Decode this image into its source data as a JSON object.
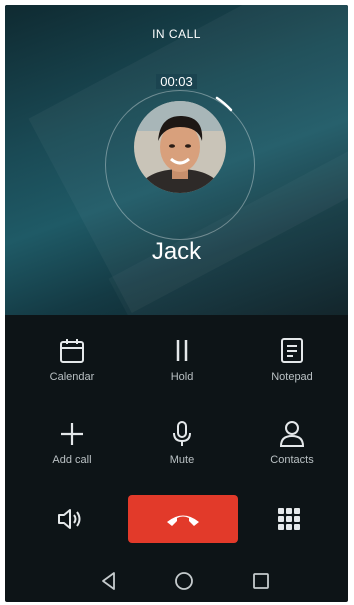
{
  "status": {
    "title": "IN CALL",
    "duration": "00:03"
  },
  "caller": {
    "name": "Jack"
  },
  "actions": [
    {
      "label": "Calendar",
      "icon": "calendar-icon"
    },
    {
      "label": "Hold",
      "icon": "pause-icon"
    },
    {
      "label": "Notepad",
      "icon": "notepad-icon"
    },
    {
      "label": "Add call",
      "icon": "plus-icon"
    },
    {
      "label": "Mute",
      "icon": "microphone-icon"
    },
    {
      "label": "Contacts",
      "icon": "person-icon"
    }
  ],
  "controls": {
    "speaker_icon": "speaker-icon",
    "end_call_icon": "phone-hangup-icon",
    "keypad_icon": "dialpad-icon",
    "end_call_color": "#e23a2a"
  },
  "navbar": {
    "back_icon": "back-triangle-icon",
    "home_icon": "home-circle-icon",
    "recents_icon": "recents-square-icon"
  }
}
